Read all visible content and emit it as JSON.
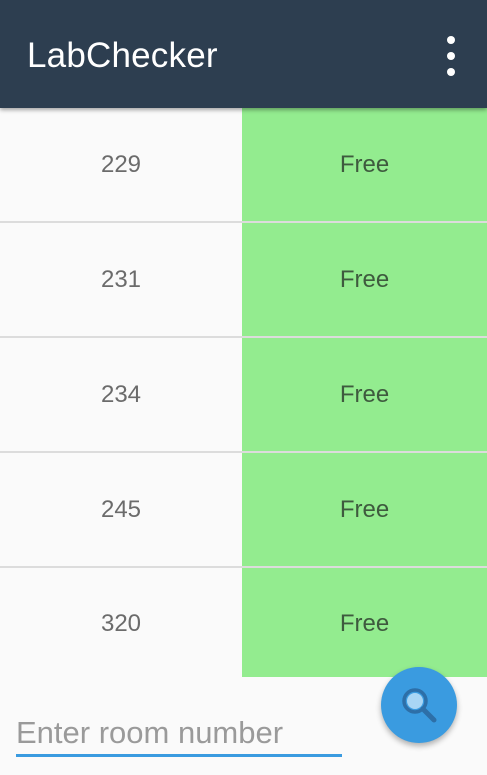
{
  "toolbar": {
    "title": "LabChecker",
    "background_color": "#2d3e50",
    "overflow_icon": "more-vert-icon"
  },
  "rooms": [
    {
      "room": "229",
      "status": "Free"
    },
    {
      "room": "231",
      "status": "Free"
    },
    {
      "room": "234",
      "status": "Free"
    },
    {
      "room": "245",
      "status": "Free"
    },
    {
      "room": "320",
      "status": "Free"
    }
  ],
  "status_colors": {
    "free": "#93ec8f"
  },
  "search": {
    "placeholder": "Enter room number",
    "value": "",
    "button_icon": "search-icon",
    "accent_color": "#3a9be0"
  }
}
